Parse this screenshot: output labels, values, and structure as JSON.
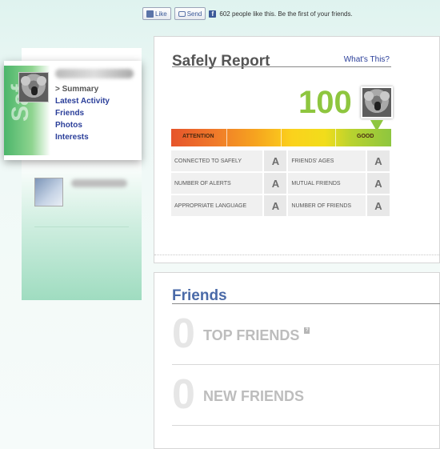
{
  "facebook_bar": {
    "like_label": "Like",
    "send_label": "Send",
    "like_count_text": "602 people like this. Be the first of your friends."
  },
  "sidebar": {
    "stripe_text": "Saf",
    "nav": [
      {
        "label": "> Summary",
        "active": true
      },
      {
        "label": "Latest Activity"
      },
      {
        "label": "Friends"
      },
      {
        "label": "Photos"
      },
      {
        "label": "Interests"
      }
    ]
  },
  "report": {
    "title": "Safely Report",
    "whats_this": "What's This?",
    "score": "100",
    "gauge": {
      "left_label": "ATTENTION",
      "right_label": "GOOD",
      "level_percent": 100,
      "colors": {
        "attention": "#e6542b",
        "good": "#8ec63f"
      }
    },
    "grades": [
      {
        "left_label": "CONNECTED TO SAFELY",
        "left_grade": "A",
        "right_label": "FRIENDS' AGES",
        "right_grade": "A"
      },
      {
        "left_label": "NUMBER OF ALERTS",
        "left_grade": "A",
        "right_label": "MUTUAL FRIENDS",
        "right_grade": "A"
      },
      {
        "left_label": "APPROPRIATE LANGUAGE",
        "left_grade": "A",
        "right_label": "NUMBER OF FRIENDS",
        "right_grade": "A"
      }
    ]
  },
  "friends": {
    "title": "Friends",
    "top_friends_count": "0",
    "top_friends_label": "TOP FRIENDS",
    "help_glyph": "?",
    "new_friends_count": "0",
    "new_friends_label": "NEW FRIENDS"
  }
}
